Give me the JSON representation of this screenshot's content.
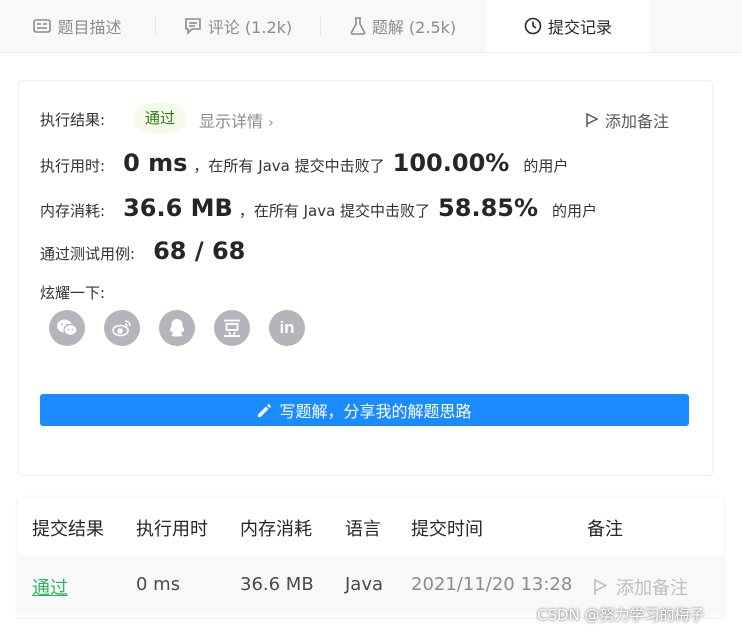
{
  "tabs": [
    {
      "label": "题目描述",
      "icon": "description-icon"
    },
    {
      "label": "评论 (1.2k)",
      "icon": "comment-icon"
    },
    {
      "label": "题解 (2.5k)",
      "icon": "flask-icon"
    },
    {
      "label": "提交记录",
      "icon": "clock-icon"
    }
  ],
  "result": {
    "label": "执行结果:",
    "status": "通过",
    "detail_link": "显示详情",
    "add_note": "添加备注"
  },
  "runtime": {
    "label": "执行用时:",
    "value": "0 ms",
    "beat_text": "，在所有 Java 提交中击败了",
    "percent": "100.00%",
    "suffix": "的用户"
  },
  "memory": {
    "label": "内存消耗:",
    "value": "36.6 MB",
    "beat_text": "，在所有 Java 提交中击败了",
    "percent": "58.85%",
    "suffix": "的用户"
  },
  "testcases": {
    "label": "通过测试用例:",
    "value": "68 / 68"
  },
  "share": {
    "label": "炫耀一下:",
    "icons": [
      "wechat-icon",
      "weibo-icon",
      "qq-icon",
      "douban-icon",
      "linkedin-icon"
    ]
  },
  "write_solution_button": "写题解，分享我的解题思路",
  "table": {
    "headers": [
      "提交结果",
      "执行用时",
      "内存消耗",
      "语言",
      "提交时间",
      "备注"
    ],
    "row": {
      "status": "通过",
      "runtime": "0 ms",
      "memory": "36.6 MB",
      "language": "Java",
      "time": "2021/11/20 13:28",
      "note": "添加备注"
    }
  },
  "watermark": "CSDN @努力学习的梅子",
  "colors": {
    "accent": "#1a8cff",
    "success": "#2db55d",
    "badge_bg": "#f4fbea"
  }
}
